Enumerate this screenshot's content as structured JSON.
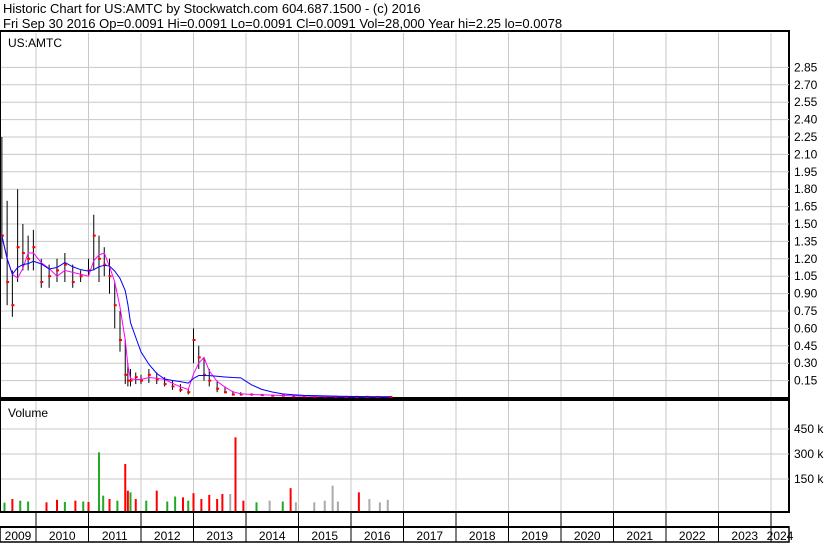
{
  "header": {
    "title": "Historic Chart for US:AMTC by Stockwatch.com 604.687.1500 - (c) 2016",
    "quote": "Fri Sep 30 2016   Op=0.0091  Hi=0.0091  Lo=0.0091  Cl=0.0091  Vol=28,000   Year hi=2.25   lo=0.0078"
  },
  "colors": {
    "price": "#000000",
    "ma_short": "#ff00ff",
    "ma_long": "#0000ff",
    "up": "#22aa22",
    "down": "#ff0000",
    "flat": "#aaaaaa",
    "grid": "#c8c8c8"
  },
  "chart_data": [
    {
      "type": "line",
      "title": "US:AMTC",
      "ylim": [
        0,
        2.95
      ],
      "yticks": [
        "0.15",
        "0.30",
        "0.45",
        "0.60",
        "0.75",
        "0.90",
        "1.05",
        "1.20",
        "1.35",
        "1.50",
        "1.65",
        "1.80",
        "1.95",
        "2.10",
        "2.25",
        "2.40",
        "2.55",
        "2.70",
        "2.85"
      ],
      "x_years": [
        "2009",
        "2010",
        "2011",
        "2012",
        "2013",
        "2014",
        "2015",
        "2016",
        "2017",
        "2018",
        "2019",
        "2020",
        "2021",
        "2022",
        "2023",
        "2024"
      ],
      "series": {
        "t": [
          2009.35,
          2009.45,
          2009.55,
          2009.65,
          2009.75,
          2009.85,
          2009.95,
          2010.1,
          2010.25,
          2010.4,
          2010.55,
          2010.7,
          2010.85,
          2011.0,
          2011.1,
          2011.2,
          2011.3,
          2011.4,
          2011.5,
          2011.6,
          2011.7,
          2011.75,
          2011.8,
          2011.9,
          2012.0,
          2012.15,
          2012.3,
          2012.45,
          2012.6,
          2012.75,
          2012.9,
          2013.0,
          2013.1,
          2013.2,
          2013.3,
          2013.45,
          2013.6,
          2013.75,
          2013.9,
          2014.1,
          2014.3,
          2014.5,
          2014.7,
          2014.9,
          2015.1,
          2015.3,
          2015.5,
          2015.7,
          2015.9,
          2016.1,
          2016.3,
          2016.5,
          2016.75
        ],
        "high": [
          2.25,
          1.7,
          1.1,
          1.8,
          1.5,
          1.4,
          1.45,
          1.2,
          1.15,
          1.2,
          1.25,
          1.15,
          1.1,
          1.2,
          1.58,
          1.4,
          1.3,
          1.2,
          1.0,
          0.75,
          0.5,
          0.3,
          0.25,
          0.22,
          0.2,
          0.25,
          0.22,
          0.18,
          0.15,
          0.12,
          0.08,
          0.6,
          0.45,
          0.35,
          0.25,
          0.15,
          0.1,
          0.06,
          0.05,
          0.04,
          0.035,
          0.03,
          0.03,
          0.025,
          0.02,
          0.02,
          0.02,
          0.018,
          0.016,
          0.015,
          0.013,
          0.012,
          0.0091
        ],
        "low": [
          1.2,
          0.8,
          0.7,
          1.0,
          1.1,
          1.1,
          1.1,
          0.95,
          0.95,
          1.0,
          1.0,
          0.95,
          1.0,
          1.05,
          1.1,
          1.0,
          1.05,
          0.9,
          0.6,
          0.4,
          0.12,
          0.1,
          0.1,
          0.12,
          0.12,
          0.13,
          0.12,
          0.1,
          0.07,
          0.05,
          0.03,
          0.3,
          0.25,
          0.15,
          0.1,
          0.05,
          0.04,
          0.02,
          0.02,
          0.02,
          0.02,
          0.015,
          0.015,
          0.012,
          0.01,
          0.01,
          0.01,
          0.009,
          0.009,
          0.008,
          0.008,
          0.0078,
          0.0091
        ],
        "close": [
          1.4,
          1.0,
          0.8,
          1.3,
          1.25,
          1.2,
          1.3,
          1.0,
          1.05,
          1.1,
          1.15,
          1.0,
          1.05,
          1.1,
          1.4,
          1.2,
          1.15,
          1.05,
          0.8,
          0.5,
          0.2,
          0.15,
          0.15,
          0.18,
          0.15,
          0.2,
          0.16,
          0.12,
          0.1,
          0.07,
          0.05,
          0.5,
          0.35,
          0.2,
          0.15,
          0.08,
          0.05,
          0.03,
          0.03,
          0.03,
          0.025,
          0.02,
          0.02,
          0.015,
          0.015,
          0.012,
          0.012,
          0.011,
          0.01,
          0.01,
          0.01,
          0.009,
          0.0091
        ]
      }
    },
    {
      "type": "bar",
      "title": "Volume",
      "ylim": [
        0,
        570
      ],
      "yticks": [
        "150 k",
        "300 k",
        "450 k"
      ],
      "ytick_values": [
        150,
        300,
        450
      ],
      "bars": [
        [
          2009.4,
          8,
          "up"
        ],
        [
          2009.55,
          30,
          "down"
        ],
        [
          2009.7,
          20,
          "up"
        ],
        [
          2009.85,
          15,
          "up"
        ],
        [
          2010.2,
          10,
          "down"
        ],
        [
          2010.4,
          25,
          "down"
        ],
        [
          2010.55,
          12,
          "up"
        ],
        [
          2010.75,
          20,
          "down"
        ],
        [
          2010.9,
          15,
          "up"
        ],
        [
          2011.0,
          12,
          "down"
        ],
        [
          2011.2,
          310,
          "up"
        ],
        [
          2011.28,
          50,
          "up"
        ],
        [
          2011.4,
          30,
          "down"
        ],
        [
          2011.55,
          20,
          "up"
        ],
        [
          2011.7,
          240,
          "down"
        ],
        [
          2011.75,
          80,
          "down"
        ],
        [
          2011.8,
          70,
          "up"
        ],
        [
          2011.9,
          30,
          "down"
        ],
        [
          2012.1,
          20,
          "up"
        ],
        [
          2012.3,
          80,
          "down"
        ],
        [
          2012.5,
          15,
          "up"
        ],
        [
          2012.65,
          45,
          "up"
        ],
        [
          2012.8,
          40,
          "down"
        ],
        [
          2012.9,
          20,
          "up"
        ],
        [
          2013.0,
          65,
          "down"
        ],
        [
          2013.15,
          30,
          "down"
        ],
        [
          2013.3,
          55,
          "down"
        ],
        [
          2013.45,
          30,
          "down"
        ],
        [
          2013.55,
          60,
          "down"
        ],
        [
          2013.7,
          60,
          "flat"
        ],
        [
          2013.8,
          400,
          "down"
        ],
        [
          2013.95,
          20,
          "down"
        ],
        [
          2014.2,
          10,
          "up"
        ],
        [
          2014.45,
          20,
          "flat"
        ],
        [
          2014.7,
          15,
          "up"
        ],
        [
          2014.85,
          95,
          "down"
        ],
        [
          2014.95,
          10,
          "flat"
        ],
        [
          2015.3,
          10,
          "flat"
        ],
        [
          2015.5,
          20,
          "flat"
        ],
        [
          2015.65,
          110,
          "flat"
        ],
        [
          2015.75,
          15,
          "flat"
        ],
        [
          2016.15,
          70,
          "down"
        ],
        [
          2016.35,
          30,
          "flat"
        ],
        [
          2016.55,
          10,
          "flat"
        ],
        [
          2016.7,
          25,
          "flat"
        ]
      ]
    }
  ]
}
